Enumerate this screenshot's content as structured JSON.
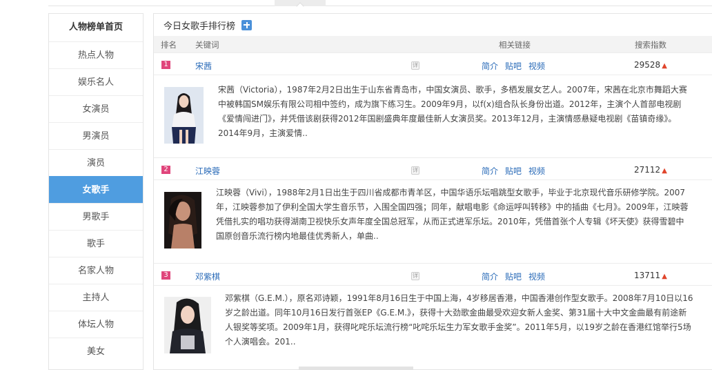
{
  "sidebar": {
    "title": "人物榜单首页",
    "items": [
      {
        "label": "热点人物"
      },
      {
        "label": "娱乐名人"
      },
      {
        "label": "女演员"
      },
      {
        "label": "男演员"
      },
      {
        "label": "演员"
      },
      {
        "label": "女歌手",
        "active": true
      },
      {
        "label": "男歌手"
      },
      {
        "label": "歌手"
      },
      {
        "label": "名家人物"
      },
      {
        "label": "主持人"
      },
      {
        "label": "体坛人物"
      },
      {
        "label": "美女"
      }
    ]
  },
  "panel": {
    "title": "今日女歌手排行榜",
    "columns": {
      "rank": "排名",
      "keyword": "关键词",
      "links": "相关链接",
      "index": "搜索指数"
    },
    "entries": [
      {
        "rank": "1",
        "name": "宋茜",
        "links": [
          "简介",
          "贴吧",
          "视频"
        ],
        "index": "29528",
        "desc": "宋茜（Victoria），1987年2月2日出生于山东省青岛市，中国女演员、歌手，多栖发展女艺人。2007年，宋茜在北京市舞蹈大赛中被韩国SM娱乐有限公司相中签约，成为旗下练习生。2009年9月，以f(x)组合队长身份出道。2012年，主演个人首部电视剧《爱情闯进门》，并凭借该剧获得2012年国剧盛典年度最佳新人女演员奖。2013年12月，主演情感悬疑电视剧《苗镇奇缘》。2014年9月，主演爱情.."
      },
      {
        "rank": "2",
        "name": "江映蓉",
        "links": [
          "简介",
          "贴吧",
          "视频"
        ],
        "index": "27112",
        "desc": "江映蓉（Vivi），1988年2月1日出生于四川省成都市青羊区，中国华语乐坛唱跳型女歌手，毕业于北京现代音乐研修学院。2007年，江映蓉参加了伊利全国大学生音乐节，入围全国四强；同年，献唱电影《命运呼叫转移》中的插曲《七月》。2009年，江映蓉凭借扎实的唱功获得湖南卫视快乐女声年度全国总冠军，从而正式进军乐坛。2010年，凭借首张个人专辑《坏天使》获得雪碧中国原创音乐流行榜内地最佳优秀新人，单曲.."
      },
      {
        "rank": "3",
        "name": "邓紫棋",
        "links": [
          "简介",
          "贴吧",
          "视频"
        ],
        "index": "13711",
        "desc": "邓紫棋（G.E.M.），原名邓诗颖，1991年8月16日生于中国上海，4岁移居香港，中国香港创作型女歌手。2008年7月10日以16岁之龄出道。同年10月16日发行首张EP《G.E.M.》，获得十大劲歌金曲最受欢迎女新人金奖、第31届十大中文金曲最有前途新人银奖等奖项。2009年1月，获得叱咤乐坛流行榜“叱咤乐坛生力军女歌手金奖”。2011年5月，以19岁之龄在香港红馆举行5场个人演唱会。201.."
      }
    ],
    "detail_icon": "详"
  },
  "colors": {
    "accent": "#4f9de0",
    "link": "#2a6bb8",
    "rank_badge": "#e0457b",
    "up_arrow": "#e0452c"
  },
  "icons": {
    "add": "plus-icon",
    "trend": "arrow-up-icon"
  }
}
